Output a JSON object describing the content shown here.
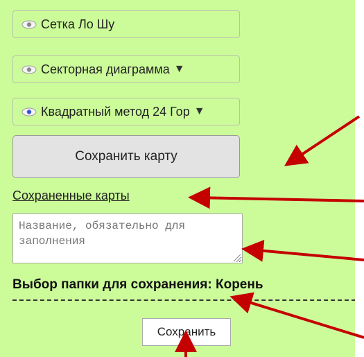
{
  "options": [
    {
      "label": "Сетка Ло Шу",
      "dropdown": false,
      "eye_color": "#8a8a8a"
    },
    {
      "label": "Секторная диаграмма",
      "dropdown": true,
      "eye_color": "#8a8a8a"
    },
    {
      "label": "Квадратный метод 24 Гор",
      "dropdown": true,
      "eye_color": "#3a55d8"
    }
  ],
  "save_map_button": "Сохранить карту",
  "saved_maps_link": "Сохраненные карты",
  "name_input": {
    "placeholder": "Название, обязательно для заполнения",
    "value": ""
  },
  "folder_select": "Выбор папки для сохранения: Корень",
  "save_button": "Сохранить",
  "colors": {
    "panel_bg": "#ccfc99",
    "arrow": "#c40000",
    "button_bg": "#e3e3e3"
  },
  "icons": {
    "visibility": "eye-icon",
    "dropdown": "triangle-down-icon",
    "resize": "resize-grip-icon",
    "annotation": "red-arrow"
  }
}
